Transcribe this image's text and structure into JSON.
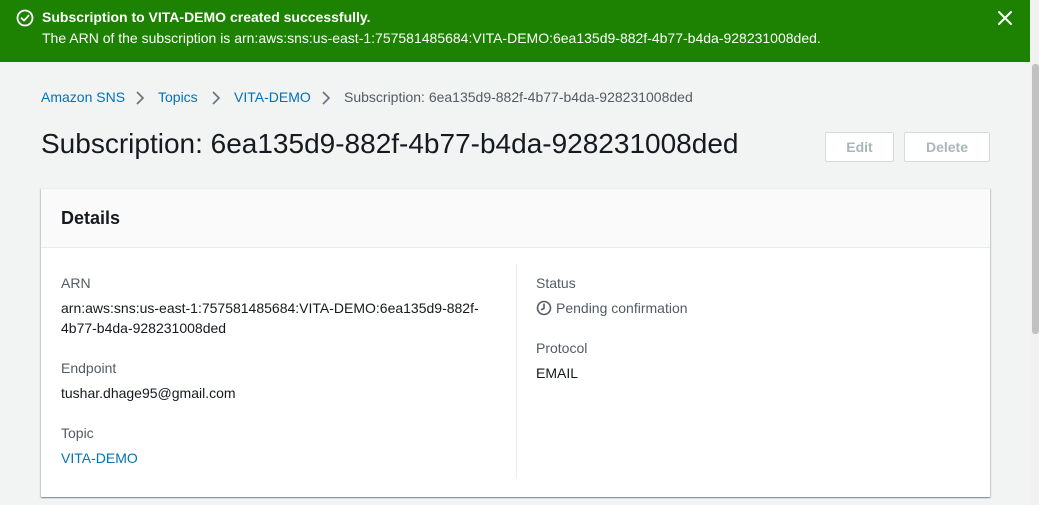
{
  "flash": {
    "title": "Subscription to VITA-DEMO created successfully.",
    "message": "The ARN of the subscription is arn:aws:sns:us-east-1:757581485684:VITA-DEMO:6ea135d9-882f-4b77-b4da-928231008ded.",
    "icon": "check-circle-icon",
    "close_icon": "close-icon",
    "color": "#1d8102"
  },
  "breadcrumb": {
    "items": [
      "Amazon SNS",
      "Topics",
      "VITA-DEMO"
    ],
    "current": "Subscription: 6ea135d9-882f-4b77-b4da-928231008ded",
    "separator_icon": "chevron-right-icon"
  },
  "page": {
    "title": "Subscription: 6ea135d9-882f-4b77-b4da-928231008ded",
    "edit_label": "Edit",
    "delete_label": "Delete"
  },
  "details": {
    "title": "Details",
    "arn_label": "ARN",
    "arn_line1": "arn:aws:sns:us-east-1:757581485684:VITA-DEMO:6ea135d9-882f-",
    "arn_line2": "4b77-b4da-928231008ded",
    "endpoint_label": "Endpoint",
    "endpoint_value": "tushar.dhage95@gmail.com",
    "topic_label": "Topic",
    "topic_value": "VITA-DEMO",
    "status_label": "Status",
    "status_value": "Pending confirmation",
    "status_icon": "clock-icon",
    "protocol_label": "Protocol",
    "protocol_value": "EMAIL"
  },
  "colors": {
    "link": "#0073bb",
    "success": "#1d8102"
  }
}
